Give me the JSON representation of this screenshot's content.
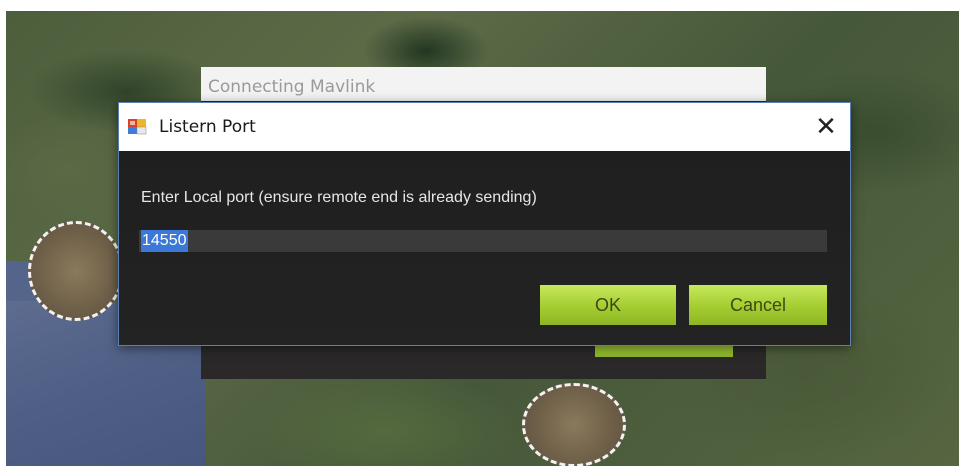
{
  "background_window": {
    "title": "Connecting Mavlink"
  },
  "dialog": {
    "title": "Listern Port",
    "close_glyph": "✕",
    "prompt": "Enter Local port (ensure remote end is already sending)",
    "port_value": "14550",
    "ok_label": "OK",
    "cancel_label": "Cancel"
  },
  "colors": {
    "button_green": "#a6cf34",
    "dialog_bg": "#1e1e1e",
    "selection_blue": "#3c78d8"
  },
  "icons": [
    "app-icon",
    "close-icon"
  ]
}
